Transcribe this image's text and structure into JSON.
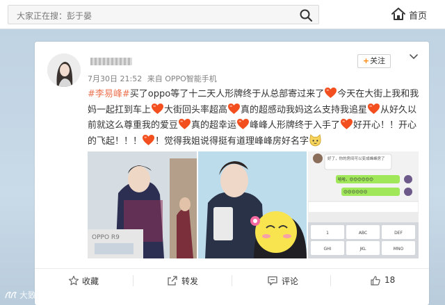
{
  "search": {
    "text": "大家正在搜：彭于晏"
  },
  "nav": {
    "home_label": "首页"
  },
  "post": {
    "time": "7月30日 21:52",
    "source": "来自 OPPO智能手机",
    "follow_label": "关注",
    "segments": [
      {
        "t": "tag",
        "v": "#李易峰#"
      },
      {
        "t": "text",
        "v": "买了oppo等了十二天人形牌终于从总部寄过来了"
      },
      {
        "t": "heart"
      },
      {
        "t": "text",
        "v": "今天在大街上我和我妈一起扛到车上"
      },
      {
        "t": "heart"
      },
      {
        "t": "text",
        "v": "大街回头率超高"
      },
      {
        "t": "heart"
      },
      {
        "t": "text",
        "v": "真的超感动我妈这么支持我追星"
      },
      {
        "t": "heart"
      },
      {
        "t": "text",
        "v": "从好久以前就这么尊重我的爱豆"
      },
      {
        "t": "heart"
      },
      {
        "t": "text",
        "v": "真的超幸运"
      },
      {
        "t": "heart"
      },
      {
        "t": "text",
        "v": "峰峰人形牌终于入手了"
      },
      {
        "t": "heart"
      },
      {
        "t": "text",
        "v": "好开心！！开心的飞起！！！"
      },
      {
        "t": "heart"
      },
      {
        "t": "text",
        "v": "！觉得我姐说得挺有道理峰峰房好名字"
      },
      {
        "t": "cat"
      }
    ],
    "photo1_label": "OPPO R9",
    "chat_messages": [
      "好了，你的房间可以变成峰峰房了",
      "哈哈，😊😊😊😊😊😊",
      "😊😊😊😊😊😊"
    ],
    "keypad": [
      "1",
      "ABC",
      "DEF",
      "GHI",
      "JKL",
      "MNO"
    ]
  },
  "actions": {
    "favorite": "收藏",
    "repost": "转发",
    "comment": "评论",
    "like_count": "18"
  },
  "watermark": "大致蓝调"
}
